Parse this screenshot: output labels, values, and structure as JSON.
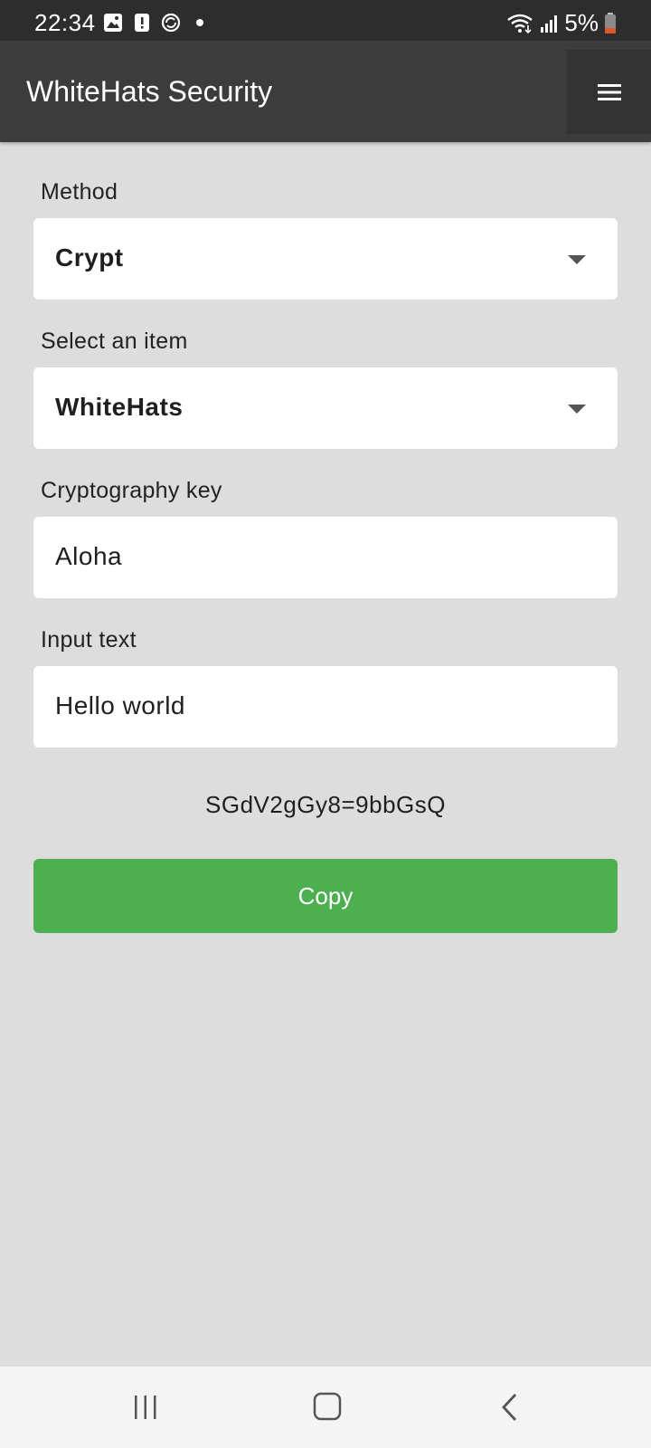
{
  "status_bar": {
    "time": "22:34",
    "battery": "5%",
    "icons_left": [
      "image-icon",
      "alert-icon",
      "sync-icon",
      "dot-icon"
    ],
    "icons_right": [
      "wifi-icon",
      "signal-icon",
      "battery-icon"
    ],
    "battery_color": "#e2572a"
  },
  "app_bar": {
    "title": "WhiteHats Security",
    "menu_icon": "hamburger-menu-icon",
    "color": "#3c3c3c"
  },
  "form": {
    "method": {
      "label": "Method",
      "value": "Crypt"
    },
    "item": {
      "label": "Select an item",
      "value": "WhiteHats"
    },
    "key": {
      "label": "Cryptography key",
      "value": "Aloha"
    },
    "input": {
      "label": "Input text",
      "value": "Hello world"
    },
    "result": "SGdV2gGy8=9bbGsQ",
    "copy_label": "Copy",
    "copy_color": "#4caf50"
  },
  "nav_bar": {
    "icons": [
      "recent-apps-icon",
      "home-icon",
      "back-icon"
    ]
  }
}
